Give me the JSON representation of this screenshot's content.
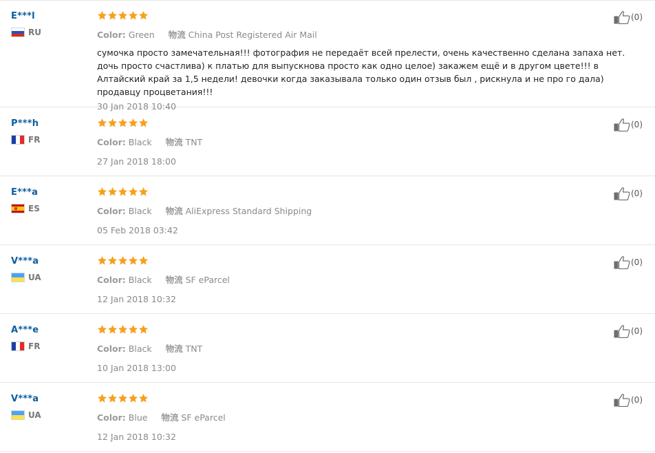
{
  "labels": {
    "color": "Color:",
    "logistics": "物流"
  },
  "colors": {
    "username": "#0d5c9c",
    "star": "#f7a01d",
    "meta": "#8a8a8a"
  },
  "reviews": [
    {
      "user": "E***l",
      "country": "RU",
      "rating": 5,
      "color": "Green",
      "shipping": "China Post Registered Air Mail",
      "feedback": "сумочка просто замечательная!!! фотография не передаёт всей прелести, очень качественно сделана запаха нет. дочь просто счастлива) к платью для выпускнова просто как одно целое) закажем ещё и в другом цвете!!! в Алтайский край за 1,5 недели! девочки когда заказывала только один отзыв был , рискнула и не про го дала) продавцу процветания!!!",
      "date": "30 Jan 2018 10:40",
      "helpful": "(0)"
    },
    {
      "user": "P***h",
      "country": "FR",
      "rating": 5,
      "color": "Black",
      "shipping": "TNT",
      "feedback": "",
      "date": "27 Jan 2018 18:00",
      "helpful": "(0)"
    },
    {
      "user": "E***a",
      "country": "ES",
      "rating": 5,
      "color": "Black",
      "shipping": "AliExpress Standard Shipping",
      "feedback": "",
      "date": "05 Feb 2018 03:42",
      "helpful": "(0)"
    },
    {
      "user": "V***a",
      "country": "UA",
      "rating": 5,
      "color": "Black",
      "shipping": "SF eParcel",
      "feedback": "",
      "date": "12 Jan 2018 10:32",
      "helpful": "(0)"
    },
    {
      "user": "A***e",
      "country": "FR",
      "rating": 5,
      "color": "Black",
      "shipping": "TNT",
      "feedback": "",
      "date": "10 Jan 2018 13:00",
      "helpful": "(0)"
    },
    {
      "user": "V***a",
      "country": "UA",
      "rating": 5,
      "color": "Blue",
      "shipping": "SF eParcel",
      "feedback": "",
      "date": "12 Jan 2018 10:32",
      "helpful": "(0)"
    }
  ]
}
